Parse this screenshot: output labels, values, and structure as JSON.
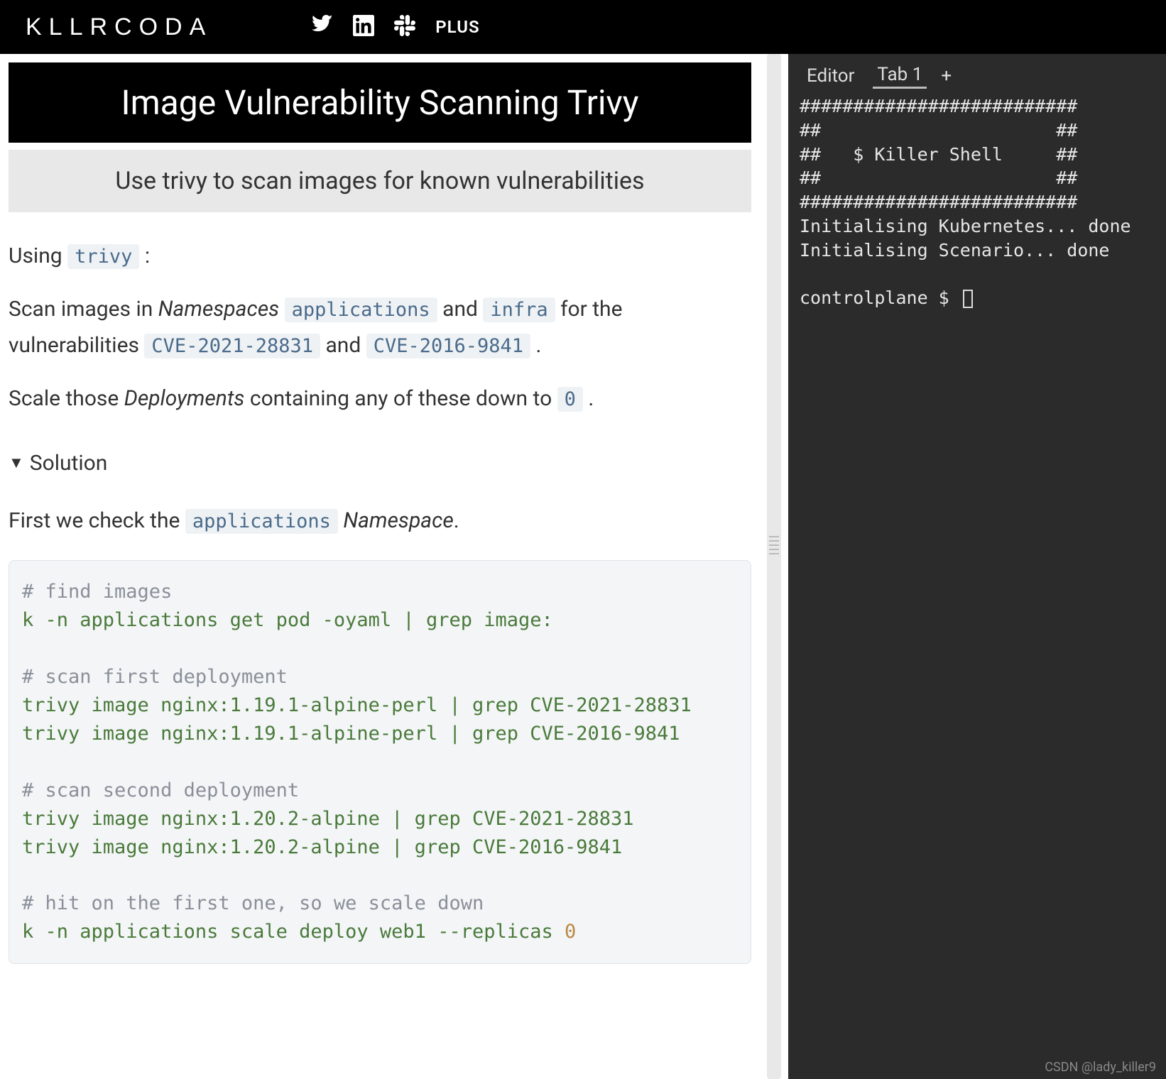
{
  "header": {
    "logo": "KLLRCODA",
    "plus": "PLUS"
  },
  "page": {
    "title": "Image Vulnerability Scanning Trivy",
    "subtitle": "Use trivy to scan images for known vulnerabilities"
  },
  "content": {
    "intro_pre": "Using ",
    "intro_code": "trivy",
    "intro_post": " :",
    "p2_a": "Scan images in ",
    "p2_ns": "Namespaces",
    "p2_b": " ",
    "p2_code1": "applications",
    "p2_c": " and ",
    "p2_code2": "infra",
    "p2_d": " for the vulnerabilities ",
    "p2_code3": "CVE-2021-28831",
    "p2_e": " and ",
    "p2_code4": "CVE-2016-9841",
    "p2_f": " .",
    "p3_a": "Scale those ",
    "p3_dep": "Deployments",
    "p3_b": " containing any of these down to ",
    "p3_code": "0",
    "p3_c": " .",
    "solution_label": "Solution",
    "sol_p1_a": "First we check the ",
    "sol_p1_code": "applications",
    "sol_p1_b": " ",
    "sol_p1_ns": "Namespace",
    "sol_p1_c": "."
  },
  "code": {
    "c1": "# find images",
    "l1": "k -n applications get pod -oyaml | grep image:",
    "c2": "# scan first deployment",
    "l2": "trivy image nginx:1.19.1-alpine-perl | grep CVE-2021-28831",
    "l3": "trivy image nginx:1.19.1-alpine-perl | grep CVE-2016-9841",
    "c3": "# scan second deployment",
    "l4": "trivy image nginx:1.20.2-alpine | grep CVE-2021-28831",
    "l5": "trivy image nginx:1.20.2-alpine | grep CVE-2016-9841",
    "c4": "# hit on the first one, so we scale down",
    "l6a": "k -n applications scale deploy web1 --replicas ",
    "l6b": "0"
  },
  "terminal": {
    "tabs": {
      "editor": "Editor",
      "tab1": "Tab 1",
      "plus": "+"
    },
    "lines": [
      "##########################",
      "##                      ##",
      "##   $ Killer Shell     ##",
      "##                      ##",
      "##########################",
      "Initialising Kubernetes... done",
      "Initialising Scenario... done",
      "",
      "controlplane $ "
    ]
  },
  "watermark": "CSDN @lady_killer9"
}
